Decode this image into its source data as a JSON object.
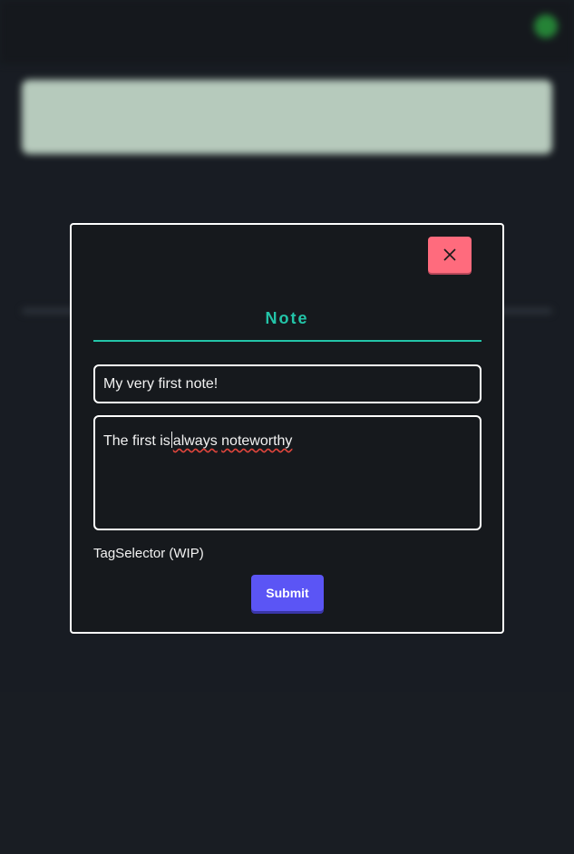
{
  "modal": {
    "title": "Note",
    "close_icon": "close-icon",
    "title_field_value": "My very first note!",
    "body_field": {
      "before_caret": "The first is",
      "after_caret_plain": " ",
      "misspelled_1": "always",
      "between": " ",
      "misspelled_2": "noteworthy"
    },
    "tag_selector_label": "TagSelector (WIP)",
    "submit_label": "Submit"
  },
  "colors": {
    "accent": "#23c4a8",
    "close_button": "#ff6b7d",
    "submit_button": "#5b55f5",
    "background": "#1e232b",
    "modal_background": "#16191d"
  }
}
